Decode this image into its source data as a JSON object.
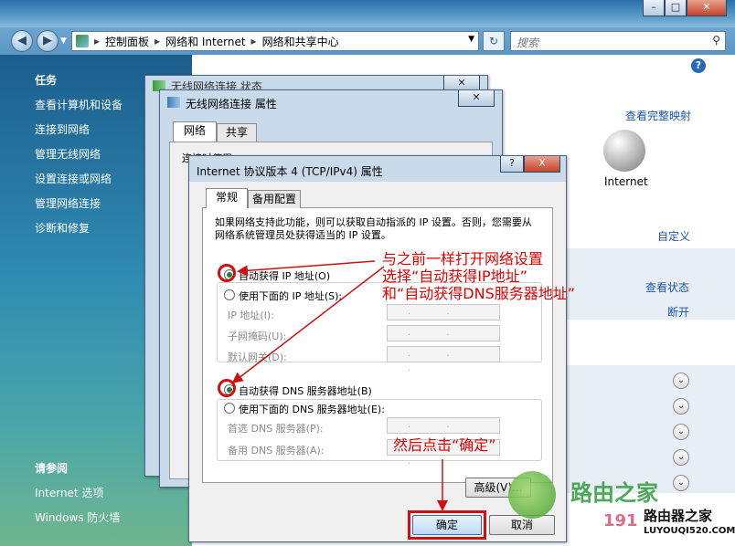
{
  "navbar": {
    "path": [
      "控制面板",
      "网络和 Internet",
      "网络和共享中心"
    ],
    "search_placeholder": "搜索"
  },
  "left": {
    "tasks_header": "任务",
    "tasks": [
      "查看计算机和设备",
      "连接到网络",
      "管理无线网络",
      "设置连接或网络",
      "管理网络连接",
      "诊断和修复"
    ],
    "see_also_header": "请参阅",
    "see_also": [
      "Internet 选项",
      "Windows 防火墙"
    ]
  },
  "content": {
    "full_map_link": "查看完整映射",
    "internet_label": "Internet",
    "customize_link": "自定义",
    "view_status_link": "查看状态",
    "disconnect_link": "断开"
  },
  "dlg_status": {
    "title": "无线网络连接 状态"
  },
  "dlg_props": {
    "title": "无线网络连接 属性",
    "tabs": [
      "网络",
      "共享"
    ],
    "connect_using_partial": "连接时使用:"
  },
  "dlg_ipv4": {
    "title": "Internet 协议版本 4 (TCP/IPv4) 属性",
    "tabs": [
      "常规",
      "备用配置"
    ],
    "description": "如果网络支持此功能，则可以获取自动指派的 IP 设置。否则，您需要从网络系统管理员处获得适当的 IP 设置。",
    "auto_ip": "自动获得 IP 地址(O)",
    "manual_ip": "使用下面的 IP 地址(S):",
    "ip_address": "IP 地址(I):",
    "subnet": "子网掩码(U):",
    "gateway": "默认网关(D):",
    "auto_dns": "自动获得 DNS 服务器地址(B)",
    "manual_dns": "使用下面的 DNS 服务器地址(E):",
    "preferred_dns": "首选 DNS 服务器(P):",
    "alternate_dns": "备用 DNS 服务器(A):",
    "advanced": "高级(V)...",
    "ok": "确定",
    "cancel": "取消",
    "help_btn": "?",
    "close_btn": "X"
  },
  "annotations": {
    "line1": "与之前一样打开网络设置",
    "line2": "选择“自动获得IP地址”",
    "line3": "和“自动获得DNS服务器地址”",
    "line4": "然后点击“确定”"
  },
  "watermark": {
    "text1": "路由之家",
    "text2": "路由器之家",
    "text3": "LUYOUQI520.COM",
    "text4": "191"
  }
}
